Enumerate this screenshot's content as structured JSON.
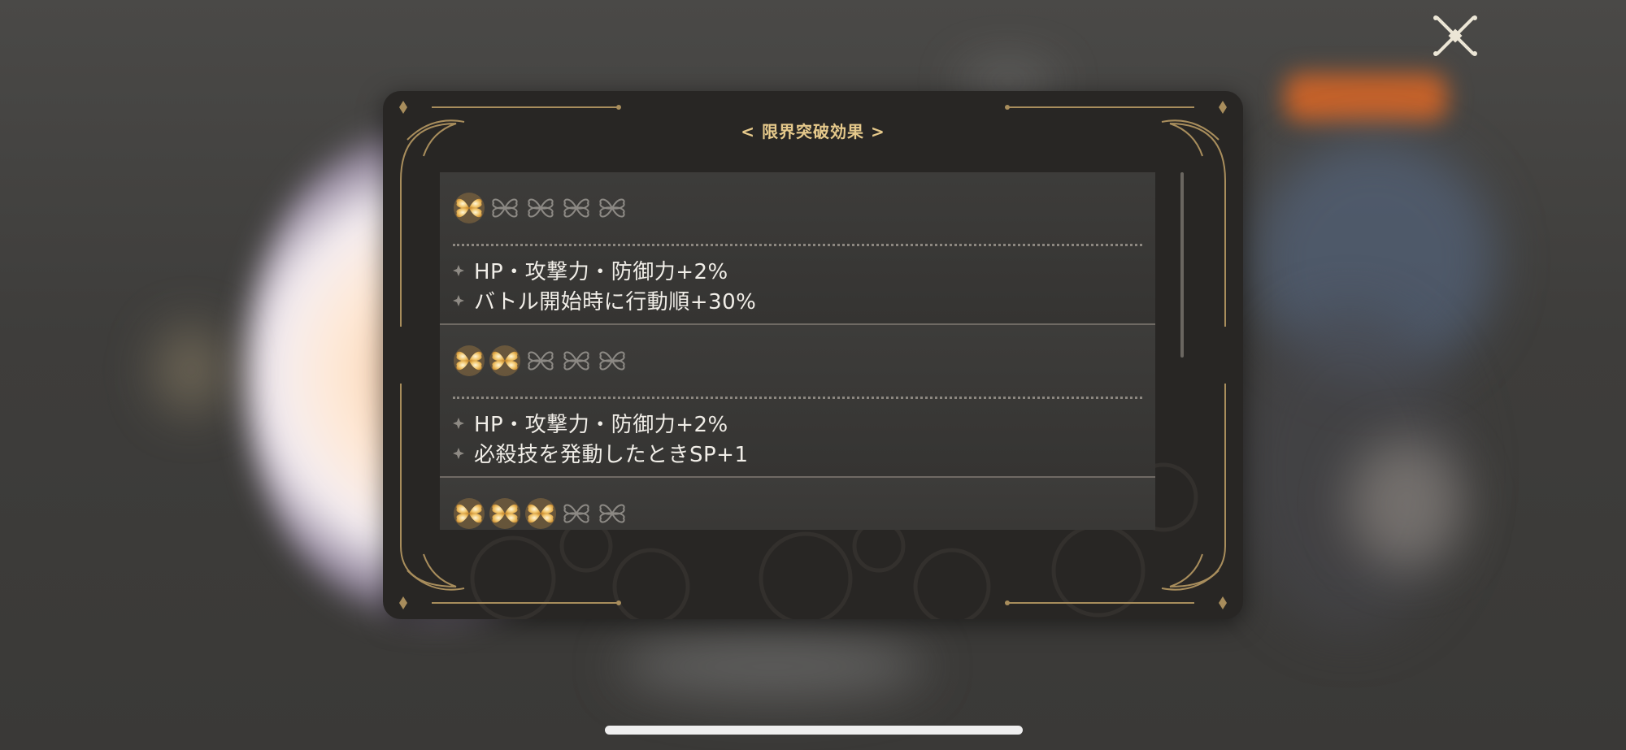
{
  "dialog": {
    "title": "< 限界突破効果 >",
    "sections": [
      {
        "filled_stars": 1,
        "total_stars": 5,
        "effects": [
          "HP・攻撃力・防御力+2%",
          "バトル開始時に行動順+30%"
        ]
      },
      {
        "filled_stars": 2,
        "total_stars": 5,
        "effects": [
          "HP・攻撃力・防御力+2%",
          "必殺技を発動したときSP+1"
        ]
      },
      {
        "filled_stars": 3,
        "total_stars": 5,
        "effects": []
      }
    ]
  },
  "icons": {
    "close": "close-icon",
    "star_filled": "star-filled-icon",
    "star_empty": "star-empty-icon",
    "bullet": "diamond-bullet-icon"
  },
  "colors": {
    "gold": "#e6c98b",
    "panel": "#282624",
    "section": "#3a3937",
    "text": "#f1eee8"
  }
}
